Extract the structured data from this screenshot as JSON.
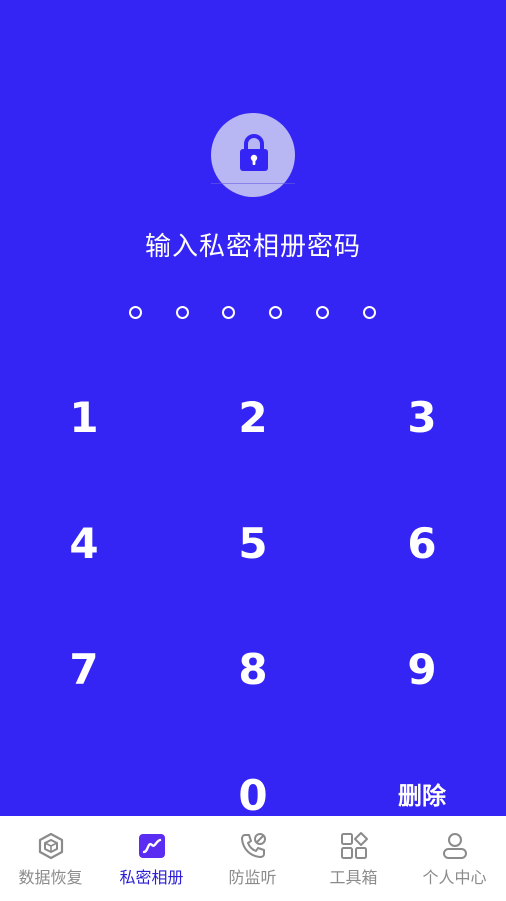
{
  "title": "输入私密相册密码",
  "keypad": {
    "keys": [
      "1",
      "2",
      "3",
      "4",
      "5",
      "6",
      "7",
      "8",
      "9",
      "0"
    ],
    "delete_label": "删除"
  },
  "tabs": [
    {
      "label": "数据恢复",
      "icon": "cube-icon",
      "active": false
    },
    {
      "label": "私密相册",
      "icon": "photo-album-icon",
      "active": true
    },
    {
      "label": "防监听",
      "icon": "phone-block-icon",
      "active": false
    },
    {
      "label": "工具箱",
      "icon": "grid-tools-icon",
      "active": false
    },
    {
      "label": "个人中心",
      "icon": "user-icon",
      "active": false
    }
  ],
  "colors": {
    "background": "#3425f5",
    "accent": "#2c1fd6",
    "lock_circle": "#b9b6f4",
    "inactive_tab": "#8b8b8b"
  },
  "pin": {
    "entered": 0,
    "length": 6
  }
}
